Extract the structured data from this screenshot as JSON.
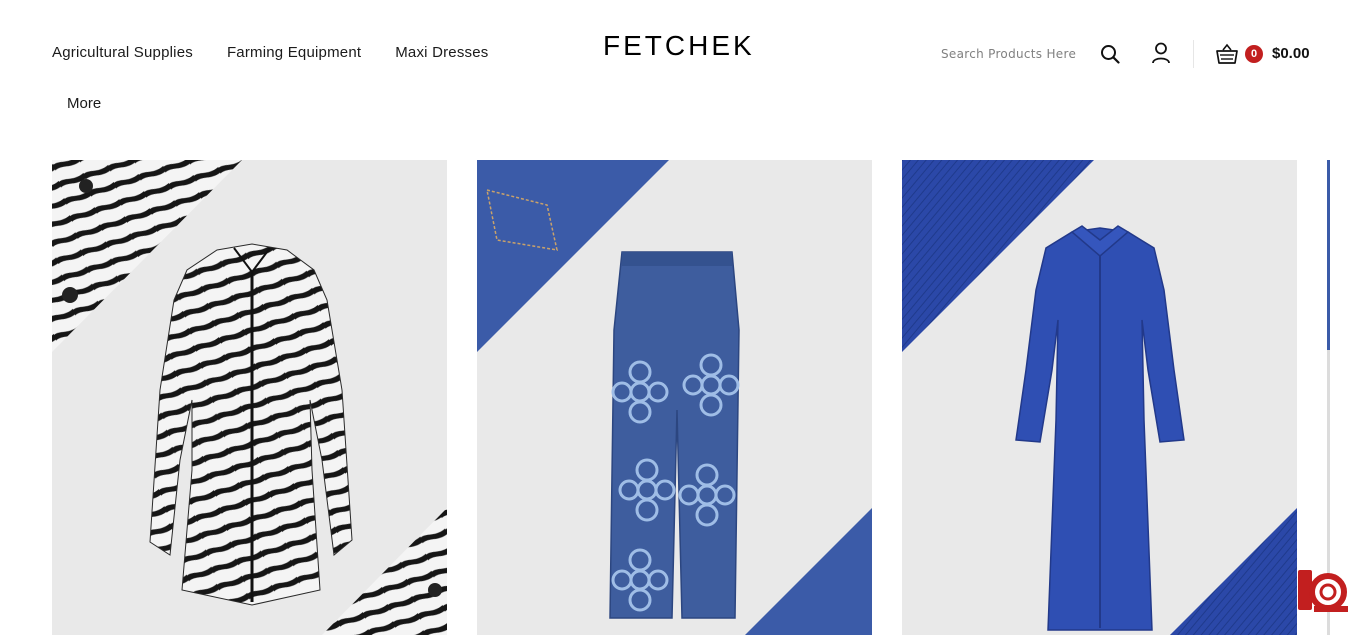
{
  "header": {
    "nav": [
      "Agricultural Supplies",
      "Farming Equipment",
      "Maxi Dresses"
    ],
    "more_label": "More",
    "logo": "FETCHEK",
    "search_placeholder": "Search Products Here",
    "cart_count": "0",
    "cart_total": "$0.00"
  },
  "icons": {
    "search": "search-icon",
    "account": "user-icon",
    "cart": "basket-icon",
    "chat": "chat-icon"
  },
  "colors": {
    "accent": "#c21f1f",
    "card_background": "#e9e9e9",
    "denim": "#3b5ba8",
    "knit_blue": "#2b48a8"
  },
  "products": [
    {
      "image": "zebra-print-shirt-dress"
    },
    {
      "image": "flower-print-denim-jeans"
    },
    {
      "image": "blue-knit-button-dress"
    }
  ]
}
